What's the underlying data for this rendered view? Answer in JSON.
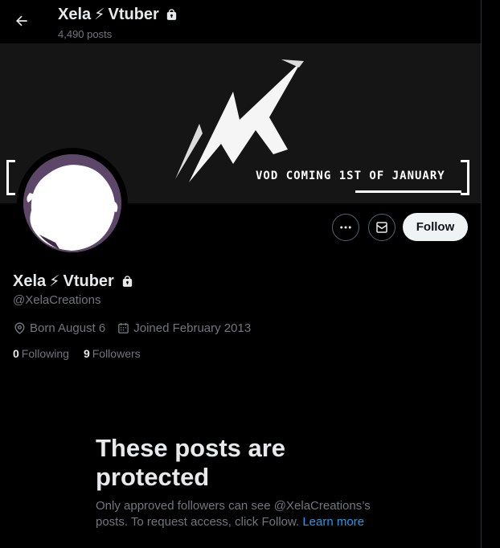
{
  "header": {
    "title_part1": "Xela",
    "bolt": "⚡",
    "title_part2": "Vtuber",
    "posts_count": "4,490 posts"
  },
  "banner": {
    "tagline": "VOD COMING 1ST OF JANUARY"
  },
  "actions": {
    "follow_label": "Follow"
  },
  "profile": {
    "name_part1": "Xela",
    "bolt": "⚡",
    "name_part2": "Vtuber",
    "handle": "@XelaCreations",
    "born": "Born August 6",
    "joined": "Joined February 2013",
    "following_count": "0",
    "following_label": "Following",
    "followers_count": "9",
    "followers_label": "Followers"
  },
  "protected": {
    "title": "These posts are protected",
    "desc": "Only approved followers can see @XelaCreations’s posts. To request access, click Follow.",
    "learn_more": "Learn more"
  },
  "colors": {
    "background": "#000000",
    "muted_text": "#71767b",
    "link": "#1d9bf0",
    "avatar_purple": "#5c4768"
  },
  "icons": [
    "back-arrow-icon",
    "lock-icon",
    "more-icon",
    "message-icon",
    "location-icon",
    "calendar-icon"
  ]
}
